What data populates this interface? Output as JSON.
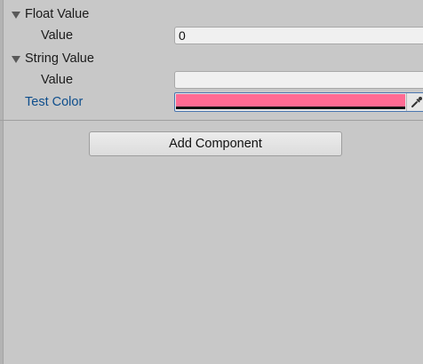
{
  "inspector": {
    "float_value": {
      "label": "Float Value",
      "field_label": "Value",
      "value": "0"
    },
    "string_value": {
      "label": "String Value",
      "field_label": "Value",
      "value": ""
    },
    "test_color": {
      "label": "Test Color",
      "color": "#ff6b93"
    },
    "add_component_label": "Add Component"
  },
  "icons": {
    "foldout": "triangle-down-icon",
    "picker": "eyedropper-icon"
  }
}
